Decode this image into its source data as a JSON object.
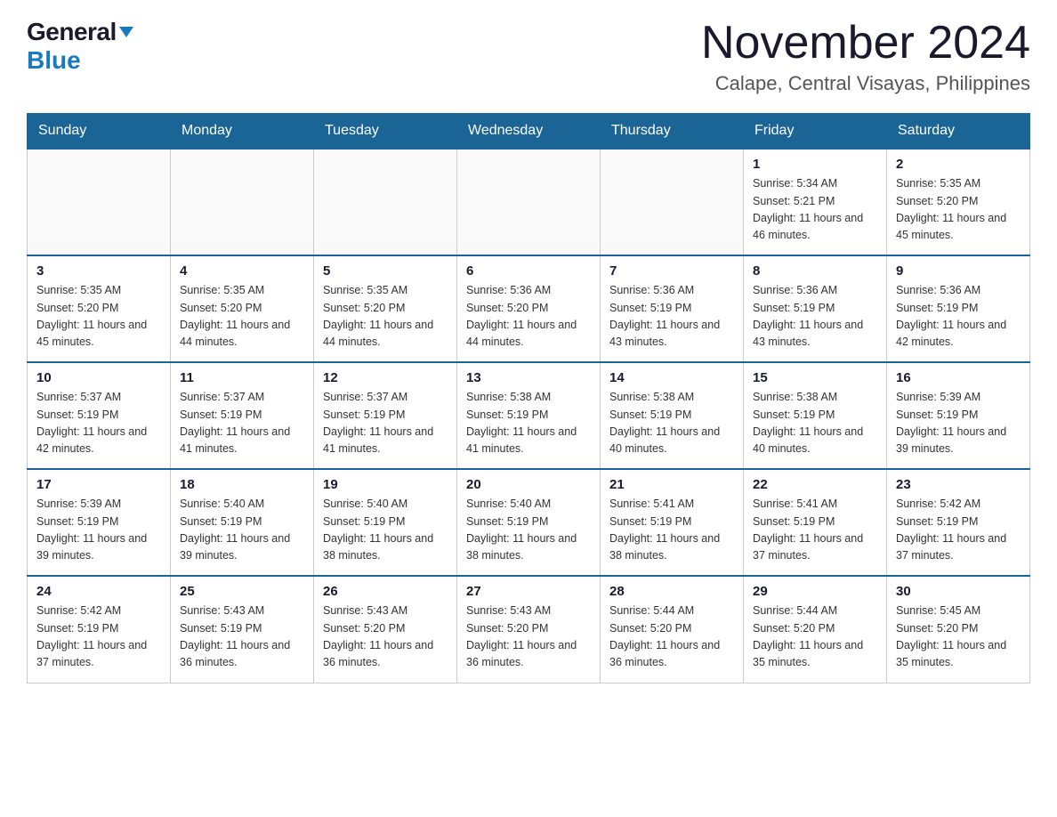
{
  "logo": {
    "general": "General",
    "blue": "Blue"
  },
  "header": {
    "title": "November 2024",
    "location": "Calape, Central Visayas, Philippines"
  },
  "days_of_week": [
    "Sunday",
    "Monday",
    "Tuesday",
    "Wednesday",
    "Thursday",
    "Friday",
    "Saturday"
  ],
  "weeks": [
    {
      "cells": [
        {
          "day": "",
          "info": ""
        },
        {
          "day": "",
          "info": ""
        },
        {
          "day": "",
          "info": ""
        },
        {
          "day": "",
          "info": ""
        },
        {
          "day": "",
          "info": ""
        },
        {
          "day": "1",
          "info": "Sunrise: 5:34 AM\nSunset: 5:21 PM\nDaylight: 11 hours\nand 46 minutes."
        },
        {
          "day": "2",
          "info": "Sunrise: 5:35 AM\nSunset: 5:20 PM\nDaylight: 11 hours\nand 45 minutes."
        }
      ]
    },
    {
      "cells": [
        {
          "day": "3",
          "info": "Sunrise: 5:35 AM\nSunset: 5:20 PM\nDaylight: 11 hours\nand 45 minutes."
        },
        {
          "day": "4",
          "info": "Sunrise: 5:35 AM\nSunset: 5:20 PM\nDaylight: 11 hours\nand 44 minutes."
        },
        {
          "day": "5",
          "info": "Sunrise: 5:35 AM\nSunset: 5:20 PM\nDaylight: 11 hours\nand 44 minutes."
        },
        {
          "day": "6",
          "info": "Sunrise: 5:36 AM\nSunset: 5:20 PM\nDaylight: 11 hours\nand 44 minutes."
        },
        {
          "day": "7",
          "info": "Sunrise: 5:36 AM\nSunset: 5:19 PM\nDaylight: 11 hours\nand 43 minutes."
        },
        {
          "day": "8",
          "info": "Sunrise: 5:36 AM\nSunset: 5:19 PM\nDaylight: 11 hours\nand 43 minutes."
        },
        {
          "day": "9",
          "info": "Sunrise: 5:36 AM\nSunset: 5:19 PM\nDaylight: 11 hours\nand 42 minutes."
        }
      ]
    },
    {
      "cells": [
        {
          "day": "10",
          "info": "Sunrise: 5:37 AM\nSunset: 5:19 PM\nDaylight: 11 hours\nand 42 minutes."
        },
        {
          "day": "11",
          "info": "Sunrise: 5:37 AM\nSunset: 5:19 PM\nDaylight: 11 hours\nand 41 minutes."
        },
        {
          "day": "12",
          "info": "Sunrise: 5:37 AM\nSunset: 5:19 PM\nDaylight: 11 hours\nand 41 minutes."
        },
        {
          "day": "13",
          "info": "Sunrise: 5:38 AM\nSunset: 5:19 PM\nDaylight: 11 hours\nand 41 minutes."
        },
        {
          "day": "14",
          "info": "Sunrise: 5:38 AM\nSunset: 5:19 PM\nDaylight: 11 hours\nand 40 minutes."
        },
        {
          "day": "15",
          "info": "Sunrise: 5:38 AM\nSunset: 5:19 PM\nDaylight: 11 hours\nand 40 minutes."
        },
        {
          "day": "16",
          "info": "Sunrise: 5:39 AM\nSunset: 5:19 PM\nDaylight: 11 hours\nand 39 minutes."
        }
      ]
    },
    {
      "cells": [
        {
          "day": "17",
          "info": "Sunrise: 5:39 AM\nSunset: 5:19 PM\nDaylight: 11 hours\nand 39 minutes."
        },
        {
          "day": "18",
          "info": "Sunrise: 5:40 AM\nSunset: 5:19 PM\nDaylight: 11 hours\nand 39 minutes."
        },
        {
          "day": "19",
          "info": "Sunrise: 5:40 AM\nSunset: 5:19 PM\nDaylight: 11 hours\nand 38 minutes."
        },
        {
          "day": "20",
          "info": "Sunrise: 5:40 AM\nSunset: 5:19 PM\nDaylight: 11 hours\nand 38 minutes."
        },
        {
          "day": "21",
          "info": "Sunrise: 5:41 AM\nSunset: 5:19 PM\nDaylight: 11 hours\nand 38 minutes."
        },
        {
          "day": "22",
          "info": "Sunrise: 5:41 AM\nSunset: 5:19 PM\nDaylight: 11 hours\nand 37 minutes."
        },
        {
          "day": "23",
          "info": "Sunrise: 5:42 AM\nSunset: 5:19 PM\nDaylight: 11 hours\nand 37 minutes."
        }
      ]
    },
    {
      "cells": [
        {
          "day": "24",
          "info": "Sunrise: 5:42 AM\nSunset: 5:19 PM\nDaylight: 11 hours\nand 37 minutes."
        },
        {
          "day": "25",
          "info": "Sunrise: 5:43 AM\nSunset: 5:19 PM\nDaylight: 11 hours\nand 36 minutes."
        },
        {
          "day": "26",
          "info": "Sunrise: 5:43 AM\nSunset: 5:20 PM\nDaylight: 11 hours\nand 36 minutes."
        },
        {
          "day": "27",
          "info": "Sunrise: 5:43 AM\nSunset: 5:20 PM\nDaylight: 11 hours\nand 36 minutes."
        },
        {
          "day": "28",
          "info": "Sunrise: 5:44 AM\nSunset: 5:20 PM\nDaylight: 11 hours\nand 36 minutes."
        },
        {
          "day": "29",
          "info": "Sunrise: 5:44 AM\nSunset: 5:20 PM\nDaylight: 11 hours\nand 35 minutes."
        },
        {
          "day": "30",
          "info": "Sunrise: 5:45 AM\nSunset: 5:20 PM\nDaylight: 11 hours\nand 35 minutes."
        }
      ]
    }
  ]
}
